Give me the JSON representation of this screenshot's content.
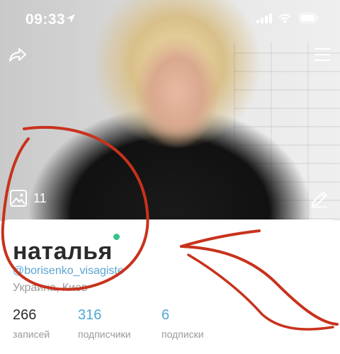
{
  "status_bar": {
    "time": "09:33"
  },
  "cover": {
    "photo_count": "11"
  },
  "profile": {
    "name": "наталья",
    "handle": "@borisenko_visagiste",
    "location": "Украина, Киев"
  },
  "stats": {
    "posts": {
      "value": "266",
      "label": "записей"
    },
    "followers": {
      "value": "316",
      "label": "подписчики"
    },
    "following": {
      "value": "6",
      "label": "подписки"
    }
  },
  "colors": {
    "accent": "#4fa8d3",
    "online": "#35c28a",
    "annotation": "#c8321c"
  },
  "icons": [
    "location-arrow-icon",
    "signal-icon",
    "wifi-icon",
    "battery-icon",
    "share-icon",
    "menu-icon",
    "gallery-icon",
    "edit-icon"
  ]
}
